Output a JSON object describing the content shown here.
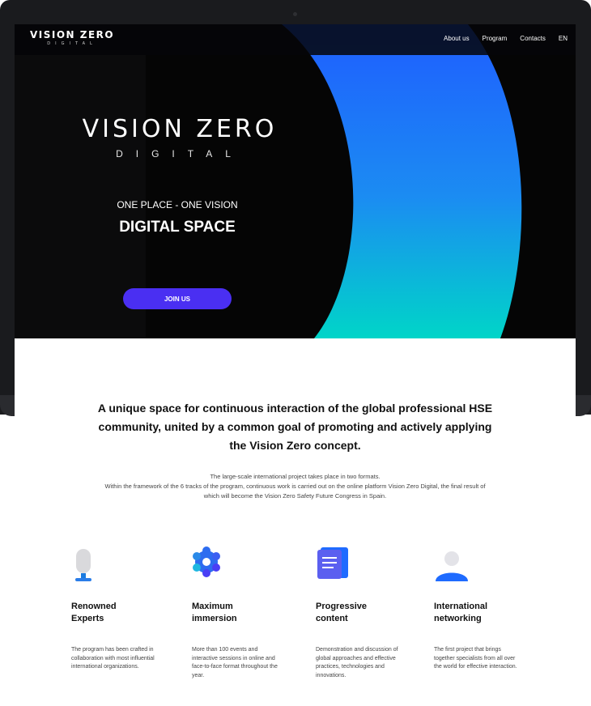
{
  "nav": {
    "logo_main": "VISION ZERO",
    "logo_sub": "DIGITAL",
    "links": [
      "About us",
      "Program",
      "Contacts",
      "EN"
    ]
  },
  "hero": {
    "logo_main": "VISION ZERO",
    "logo_sub": "DIGITAL",
    "tagline": "ONE PLACE - ONE VISION",
    "headline": "DIGITAL SPACE",
    "cta_label": "JOIN US"
  },
  "intro": {
    "heading": "A unique space for continuous interaction of the global professional HSE community, united by a common goal of promoting and actively applying the Vision Zero concept.",
    "description_line1": "The large-scale international project takes place in two formats.",
    "description_line2": "Within the framework of the 6 tracks of the program, continuous work is carried out on the online platform Vision Zero Digital, the final result of which will become the Vision Zero Safety Future Congress in Spain."
  },
  "features": [
    {
      "icon": "microphone-icon",
      "title": "Renowned Experts",
      "text": "The program has been crafted in collaboration with most influential international organizations."
    },
    {
      "icon": "gear-icon",
      "title": "Maximum immersion",
      "text": "More than 100 events and interactive sessions in online and face-to-face format throughout the year."
    },
    {
      "icon": "document-icon",
      "title": "Progressive content",
      "text": "Demonstration and discussion of global approaches and effective practices, technologies and innovations."
    },
    {
      "icon": "person-icon",
      "title": "International networking",
      "text": "The first project that brings together specialists from all over the world for effective interaction."
    }
  ],
  "colors": {
    "accent": "#4a2ff2",
    "arc_blue": "#1f6bff",
    "arc_cyan": "#00d5c8",
    "hero_bg": "#0b0b0c"
  }
}
